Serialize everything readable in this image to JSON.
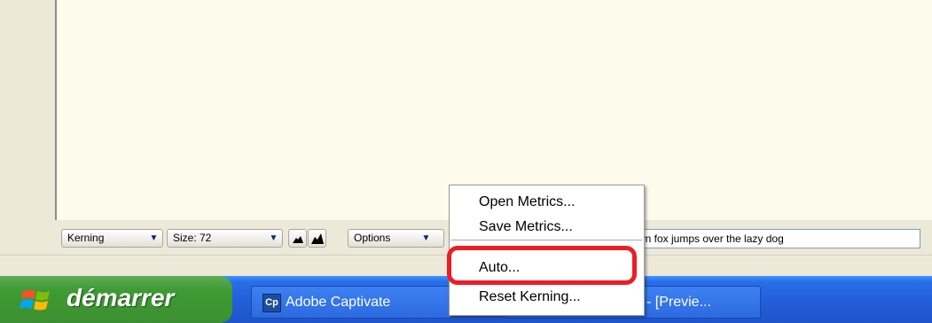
{
  "toolbar": {
    "kerning_label": "Kerning",
    "size_label": "Size: 72",
    "options_label": "Options",
    "sample_text": "wn fox jumps over the lazy dog"
  },
  "context_menu": {
    "items": [
      {
        "label": "Open Metrics..."
      },
      {
        "label": "Save Metrics..."
      },
      {
        "label": "Auto..."
      },
      {
        "label": "Reset Kerning..."
      }
    ]
  },
  "taskbar": {
    "start_label": "démarrer",
    "tasks": [
      {
        "icon_text": "Cp",
        "label": "Adobe Captivate"
      },
      {
        "label": "- [Previe..."
      }
    ]
  },
  "colors": {
    "highlight": "#ee1c24",
    "taskbar": "#245edb",
    "start": "#3c8f30",
    "canvas": "#fdfbeb"
  }
}
